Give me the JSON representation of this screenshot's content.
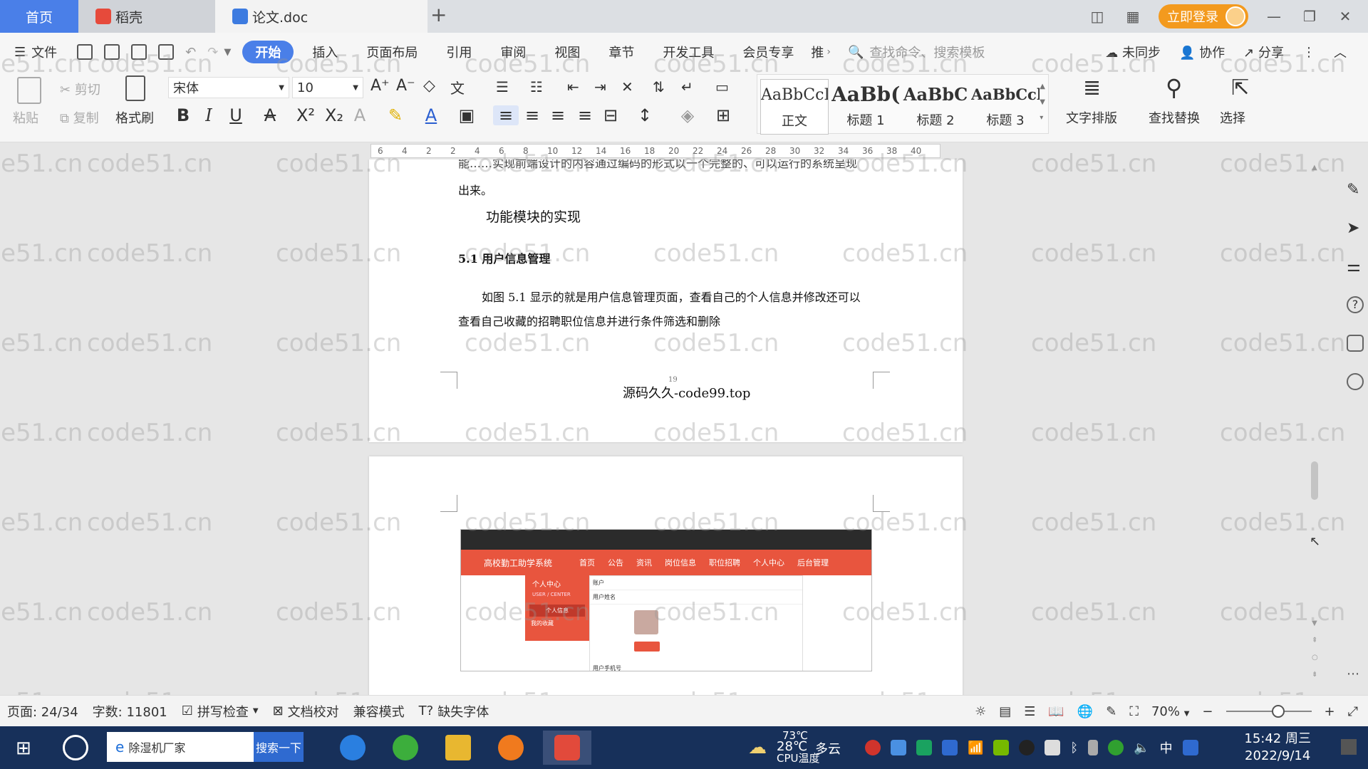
{
  "tabs": {
    "home": "首页",
    "daoke": "稻壳",
    "doc": "论文.doc",
    "add": "+"
  },
  "titlebar": {
    "login": "立即登录"
  },
  "menu": {
    "file": "文件",
    "items": [
      "开始",
      "插入",
      "页面布局",
      "引用",
      "审阅",
      "视图",
      "章节",
      "开发工具",
      "会员专享",
      "推"
    ],
    "search_cmd": "查找命令、搜索模板",
    "unsync": "未同步",
    "collab": "协作",
    "share": "分享"
  },
  "ribbon": {
    "paste": "粘贴",
    "cut": "剪切",
    "copy": "复制",
    "format_painter": "格式刷",
    "font_name": "宋体",
    "font_size": "10",
    "styles": [
      {
        "sample": "AaBbCcI",
        "label": "正文"
      },
      {
        "sample": "AaBb(",
        "label": "标题 1"
      },
      {
        "sample": "AaBbC",
        "label": "标题 2"
      },
      {
        "sample": "AaBbCcl",
        "label": "标题 3"
      }
    ],
    "text_layout": "文字排版",
    "find_replace": "查找替换",
    "select": "选择"
  },
  "ruler": {
    "ticks": [
      "6",
      "4",
      "2",
      "2",
      "4",
      "6",
      "8",
      "10",
      "12",
      "14",
      "16",
      "18",
      "20",
      "22",
      "24",
      "26",
      "28",
      "30",
      "32",
      "34",
      "36",
      "38",
      "40"
    ]
  },
  "document": {
    "cut_line": "能……实现前端设计的内容通过编码的形式以一个完整的、可以运行的系统呈现",
    "line_out": "出来。",
    "heading_module": "功能模块的实现",
    "section_title": "5.1 用户信息管理",
    "para_line1": "如图 5.1 显示的就是用户信息管理页面，查看自己的个人信息并修改还可以",
    "para_line2": "查看自己收藏的招聘职位信息并进行条件筛选和删除",
    "page_number": "19",
    "footer": "源码久久-code99.top",
    "screenshot_app_title": "高校勤工助学系统",
    "screenshot_nav": [
      "首页",
      "公告",
      "资讯",
      "岗位信息",
      "职位招聘",
      "个人中心",
      "后台管理"
    ],
    "screenshot_side_title": "个人中心",
    "screenshot_side_sub": "USER / CENTER",
    "screenshot_side_items": [
      "个人信息",
      "我的收藏"
    ],
    "screenshot_fields": [
      "账户",
      "用户姓名",
      "用户手机号"
    ]
  },
  "watermark": "code51.cn",
  "status": {
    "page": "页面: 24/34",
    "words": "字数: 11801",
    "spell": "拼写检查",
    "proof": "文档校对",
    "compat": "兼容模式",
    "missing_font": "缺失字体",
    "zoom": "70%"
  },
  "taskbar": {
    "search_value": "除湿机厂家",
    "search_btn": "搜索一下",
    "weather_temp": "28℃",
    "weather_desc": "多云",
    "cpu": "73℃",
    "cpu_label": "CPU温度",
    "ime": "中",
    "time": "15:42 周三",
    "date": "2022/9/14"
  },
  "colors": {
    "accent": "#4a7fe8",
    "login": "#f39a1e",
    "taskbar": "#17305a",
    "site_red": "#e8553e"
  }
}
